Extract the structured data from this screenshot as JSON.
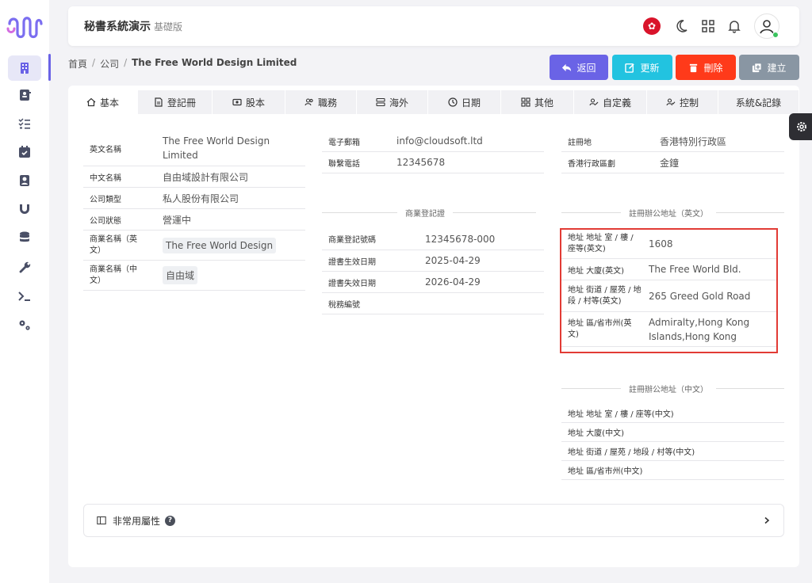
{
  "header": {
    "title": "秘書系統演示",
    "edition": "基礎版"
  },
  "breadcrumb": {
    "home": "首頁",
    "section": "公司",
    "current": "The Free World Design Limited"
  },
  "actions": {
    "back": "返回",
    "update": "更新",
    "delete": "刪除",
    "create": "建立"
  },
  "colors": {
    "back": "#6a63e6",
    "update": "#22c3e0",
    "delete": "#ff3a1a",
    "create": "#8996a3",
    "accent": "#6a63e6",
    "highlight": "#e23b35"
  },
  "tabs": [
    {
      "label": "基本",
      "icon": "home-icon"
    },
    {
      "label": "登記冊",
      "icon": "document-icon"
    },
    {
      "label": "股本",
      "icon": "money-icon"
    },
    {
      "label": "職務",
      "icon": "users-icon"
    },
    {
      "label": "海外",
      "icon": "server-icon"
    },
    {
      "label": "日期",
      "icon": "clock-icon"
    },
    {
      "label": "其他",
      "icon": "grid-icon"
    },
    {
      "label": "自定義",
      "icon": "user-edit-icon"
    },
    {
      "label": "控制",
      "icon": "user-check-icon"
    },
    {
      "label": "系統&記錄",
      "icon": ""
    }
  ],
  "basic": {
    "english_name_label": "英文名稱",
    "english_name": "The Free World Design Limited",
    "chinese_name_label": "中文名稱",
    "chinese_name": "自由域設計有限公司",
    "company_type_label": "公司類型",
    "company_type": "私人股份有限公司",
    "company_status_label": "公司狀態",
    "company_status": "營運中",
    "trade_name_en_label": "商業名稱（英文）",
    "trade_name_en": "The Free World Design",
    "trade_name_zh_label": "商業名稱（中文）",
    "trade_name_zh": "自由域"
  },
  "contact": {
    "email_label": "電子郵箱",
    "email": "info@cloudsoft.ltd",
    "phone_label": "聯繫電話",
    "phone": "12345678"
  },
  "br": {
    "section_title": "商業登記證",
    "number_label": "商業登記號碼",
    "number": "12345678-000",
    "effective_label": "證書生效日期",
    "effective": "2025-04-29",
    "expiry_label": "證書失效日期",
    "expiry": "2026-04-29",
    "tax_label": "稅務編號",
    "tax": ""
  },
  "registration": {
    "place_label": "註冊地",
    "place": "香港特別行政區",
    "district_label": "香港行政區劃",
    "district": "金鐘"
  },
  "address_en": {
    "section_title": "註冊辦公地址（英文）",
    "room_label": "地址 地址 室 / 樓 / 座等(英文)",
    "room": "1608",
    "building_label": "地址 大廈(英文)",
    "building": "The Free World Bld.",
    "street_label": "地址 街道 / 屋苑 / 地段 / 村等(英文)",
    "street": "265 Greed Gold Road",
    "region_label": "地址 區/省市州(英文)",
    "region": "Admiralty,Hong Kong Islands,Hong Kong"
  },
  "address_zh": {
    "section_title": "註冊辦公地址（中文）",
    "room_label": "地址 地址 室 / 樓 / 座等(中文)",
    "building_label": "地址 大廈(中文)",
    "street_label": "地址 街道 / 屋苑 / 地段 / 村等(中文)",
    "region_label": "地址 區/省市州(中文)"
  },
  "uncommon": {
    "label": "非常用屬性"
  }
}
